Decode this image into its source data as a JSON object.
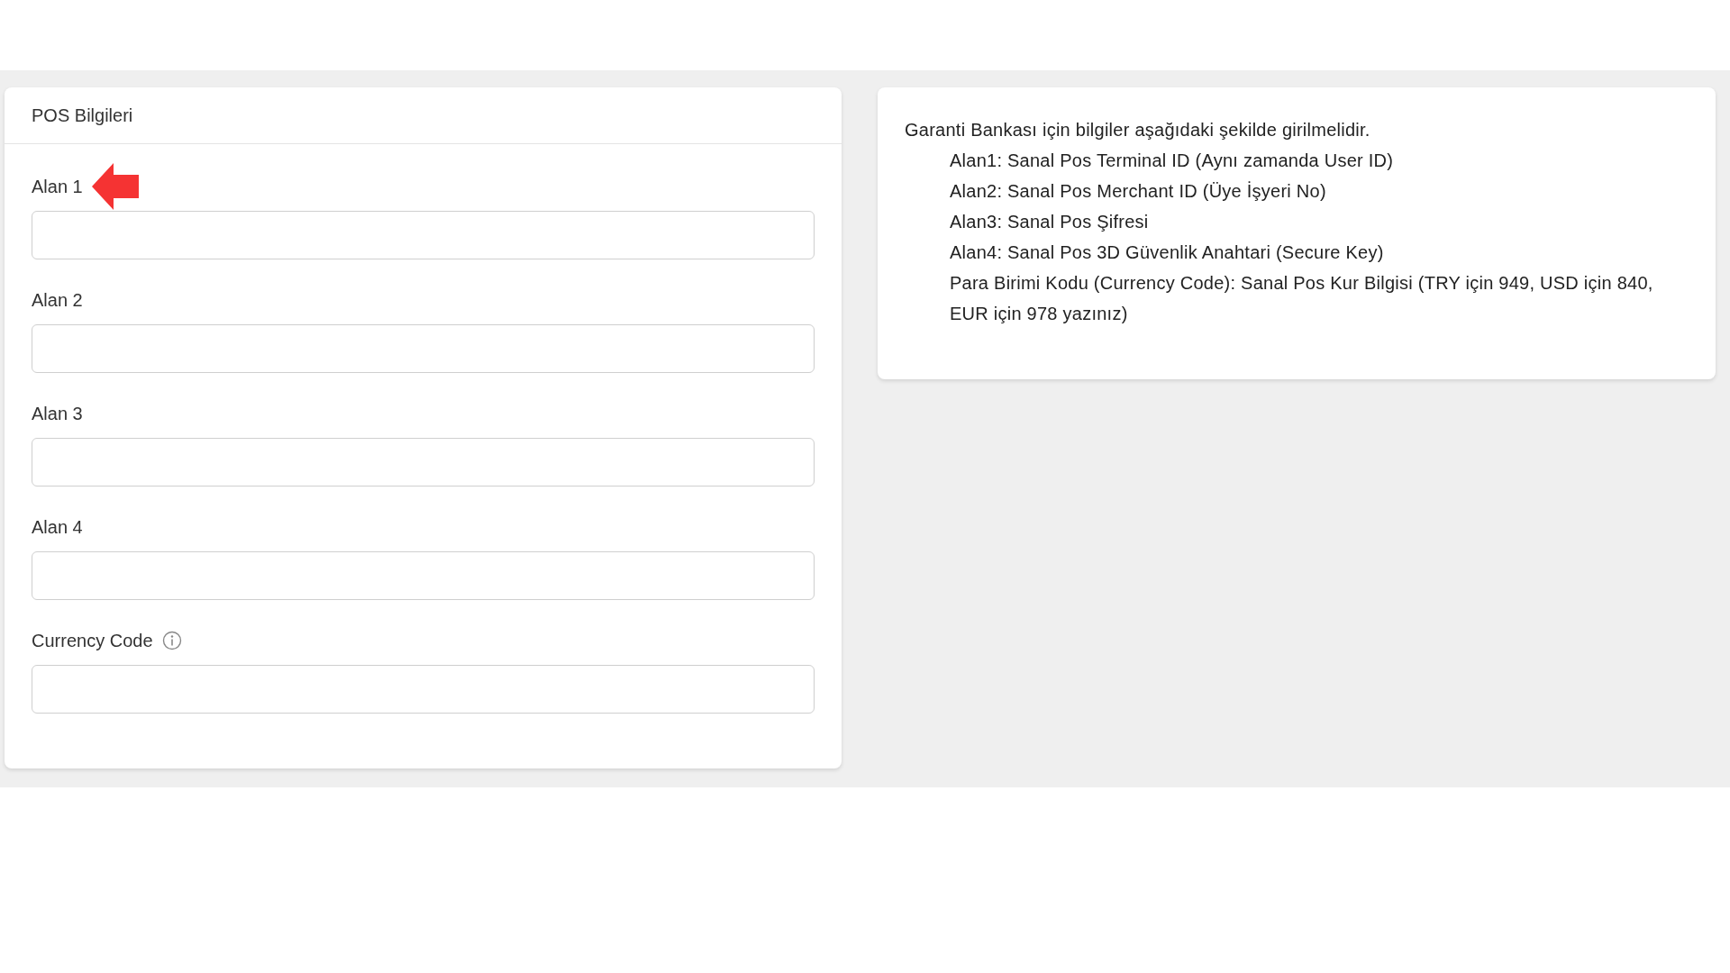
{
  "pos_card": {
    "title": "POS Bilgileri",
    "fields": [
      {
        "label": "Alan 1",
        "info": false,
        "pointer_arrow": true
      },
      {
        "label": "Alan 2",
        "info": false,
        "pointer_arrow": false
      },
      {
        "label": "Alan 3",
        "info": false,
        "pointer_arrow": false
      },
      {
        "label": "Alan 4",
        "info": false,
        "pointer_arrow": false
      },
      {
        "label": "Currency Code",
        "info": true,
        "pointer_arrow": false
      }
    ]
  },
  "help_card": {
    "intro": "Garanti Bankası için bilgiler aşağıdaki şekilde girilmelidir.",
    "lines": [
      "Alan1: Sanal Pos Terminal ID (Aynı zamanda User ID)",
      "Alan2: Sanal Pos Merchant ID (Üye İşyeri No)",
      "Alan3: Sanal Pos Şifresi",
      "Alan4: Sanal Pos 3D Güvenlik Anahtari (Secure Key)",
      "Para Birimi Kodu (Currency Code): Sanal Pos Kur Bilgisi (TRY için 949, USD için 840, EUR için 978 yazınız)"
    ]
  }
}
